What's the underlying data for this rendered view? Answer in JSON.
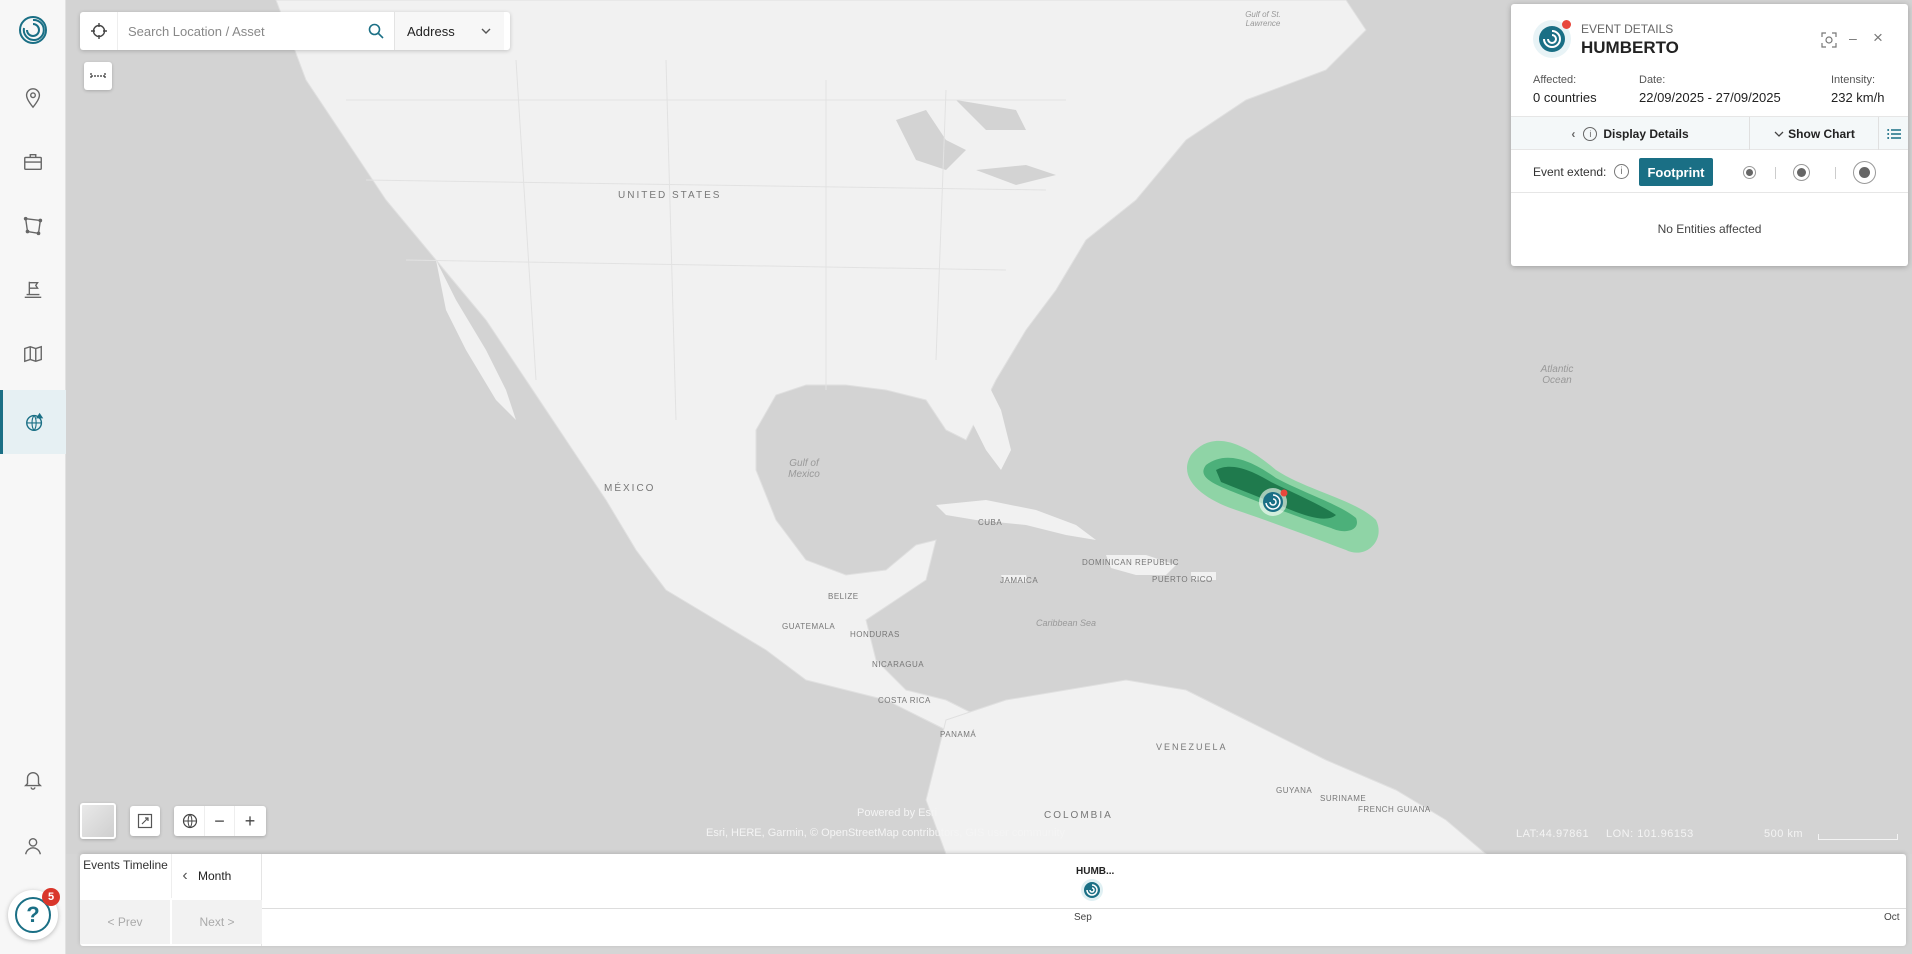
{
  "search": {
    "placeholder": "Search Location / Asset",
    "mode": "Address"
  },
  "sidebar": {
    "help_badge": "5",
    "items": [
      "location-pin-icon",
      "briefcase-icon",
      "polygon-icon",
      "flag-icon",
      "map-icon",
      "globe-events-icon",
      "bell-icon",
      "user-icon"
    ]
  },
  "map_labels": {
    "us": "UNITED STATES",
    "mexico": "MÉXICO",
    "gulf_mexico": "Gulf of Mexico",
    "atlantic": "Atlantic Ocean",
    "caribbean": "Caribbean Sea",
    "gulf_st": "Gulf of St. Lawrence",
    "cuba": "CUBA",
    "dominican": "DOMINICAN REPUBLIC",
    "puerto_rico": "PUERTO RICO",
    "jamaica": "JAMAICA",
    "belize": "BELIZE",
    "guatemala": "GUATEMALA",
    "honduras": "HONDURAS",
    "nicaragua": "NICARAGUA",
    "costa_rica": "COSTA RICA",
    "panama": "PANAMÁ",
    "venezuela": "VENEZUELA",
    "colombia": "COLOMBIA",
    "guyana": "GUYANA",
    "suriname": "SURINAME",
    "french_guiana": "FRENCH GUIANA"
  },
  "attribution": {
    "powered": "Powered by Esri",
    "credits": "Esri, HERE, Garmin, © OpenStreetMap contributors, GIS user community"
  },
  "coords": {
    "lat": "LAT:44.97861",
    "lon": "LON: 101.96153"
  },
  "scale": "500 km",
  "timeline": {
    "title": "Events Timeline",
    "period": "Month",
    "prev": "< Prev",
    "next": "Next >",
    "event_label": "HUMB...",
    "ticks": [
      "Sep",
      "Oct"
    ]
  },
  "event": {
    "kicker": "EVENT DETAILS",
    "name": "HUMBERTO",
    "affected_label": "Affected:",
    "affected_value": "0 countries",
    "date_label": "Date:",
    "date_value": "22/09/2025 - 27/09/2025",
    "intensity_label": "Intensity:",
    "intensity_value": "232 km/h",
    "display_details": "Display Details",
    "show_chart": "Show Chart",
    "extend_label": "Event extend:",
    "footprint": "Footprint",
    "empty": "No Entities affected"
  },
  "colors": {
    "accent": "#1a6f85",
    "footprint_outer": "#8fd4a6",
    "footprint_mid": "#4cb07a",
    "footprint_inner": "#1f7a4d"
  }
}
